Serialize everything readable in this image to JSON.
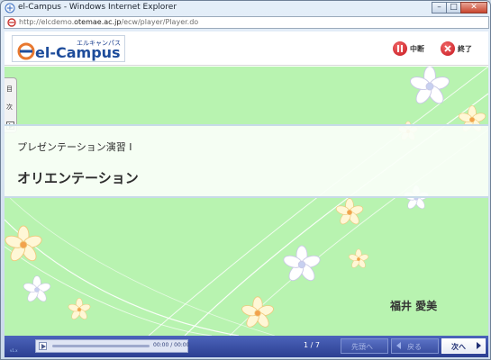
{
  "window": {
    "title": "el-Campus - Windows Internet Explorer",
    "address_prefix": "http://elcdemo.",
    "address_host": "otemae.ac.jp",
    "address_path": "/ecw/player/Player.do"
  },
  "header": {
    "logo_kana": "エルキャンパス",
    "logo_text": "el-Campus",
    "pause_label": "中断",
    "end_label": "終了"
  },
  "toc": {
    "label_top": "目",
    "label_bottom": "次"
  },
  "slide": {
    "course_title": "プレゼンテーション演習 I",
    "lecture_title": "オリエンテーション",
    "presenter": "福井 愛美"
  },
  "footer": {
    "version": "v1.x",
    "time": "00:00 / 00:00",
    "page": "1 / 7",
    "prev_chapter_label": "先頭へ",
    "back_label": "戻る",
    "next_label": "次へ"
  },
  "colors": {
    "slide_bg": "#b8f3b0",
    "footer_bg": "#3a4fa1",
    "accent_red": "#c5141c",
    "logo_blue": "#1d4c9b"
  }
}
